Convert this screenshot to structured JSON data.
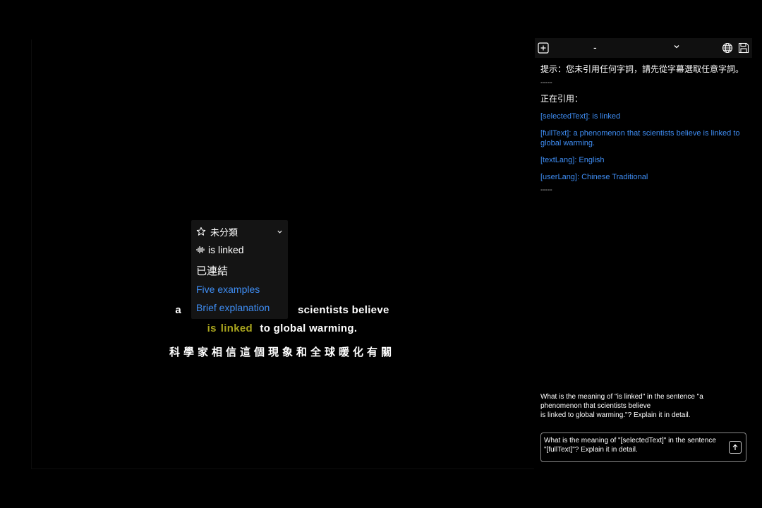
{
  "popup": {
    "category_label": "未分類",
    "term": "is linked",
    "translation": "已連結",
    "links": [
      "Five examples",
      "Brief explanation"
    ]
  },
  "subtitles": {
    "line1_prefix": "a",
    "line1_suffix": "scientists believe",
    "line2_highlight_1": "is",
    "line2_highlight_2": "linked",
    "line2_rest": "to global warming.",
    "translation_line": "科學家相信這個現象和全球暖化有關"
  },
  "panel": {
    "header": {
      "model_label": "-"
    },
    "hint": "提示：您未引用任何字詞，請先從字幕選取任意字詞。",
    "separator": "-----",
    "quoting_label": "正在引用：",
    "refs": [
      "[selectedText]: is linked",
      "[fullText]: a phenomenon that scientists believe is linked to global warming.",
      "[textLang]: English",
      "[userLang]: Chinese Traditional"
    ],
    "question": "What is the meaning of \"is linked\" in the sentence \"a phenomenon that scientists believe\nis linked to global warming.\"? Explain it in detail.",
    "input_value": "What is the meaning of \"[selectedText]\" in the sentence \"[fullText]\"? Explain it in detail."
  },
  "colors": {
    "link": "#3f8ef5",
    "highlight": "#a9a51e",
    "background": "#000000"
  }
}
